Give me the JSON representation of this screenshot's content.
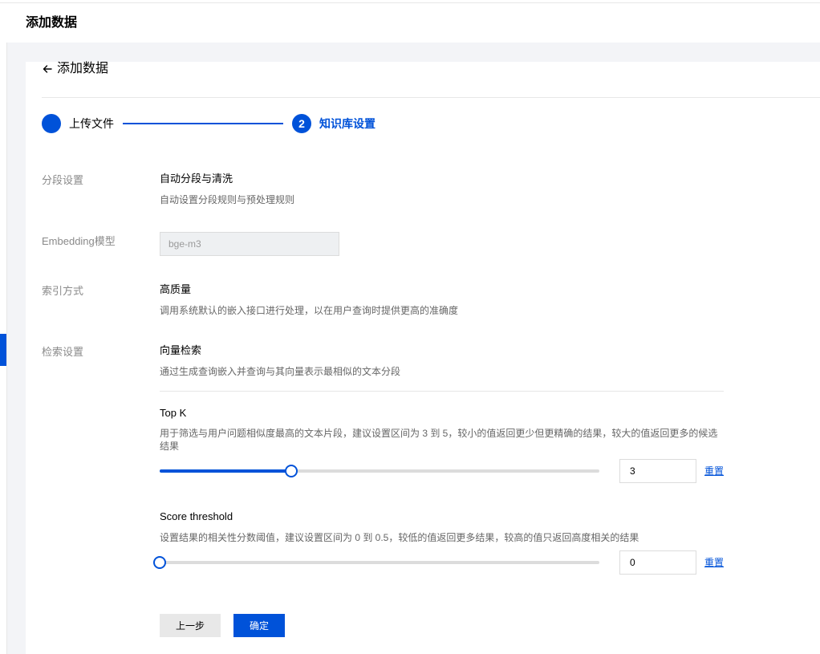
{
  "header": {
    "title": "添加数据"
  },
  "back": {
    "label": "添加数据"
  },
  "steps": [
    {
      "number": "",
      "label": "上传文件",
      "status": "done"
    },
    {
      "number": "2",
      "label": "知识库设置",
      "status": "active"
    }
  ],
  "form": {
    "segment": {
      "label": "分段设置",
      "option_title": "自动分段与清洗",
      "option_desc": "自动设置分段规则与预处理规则"
    },
    "embedding": {
      "label": "Embedding模型",
      "placeholder": "bge-m3"
    },
    "index": {
      "label": "索引方式",
      "option_title": "高质量",
      "option_desc": "调用系统默认的嵌入接口进行处理，以在用户查询时提供更高的准确度"
    },
    "retrieval": {
      "label": "检索设置",
      "option_title": "向量检索",
      "option_desc": "通过生成查询嵌入并查询与其向量表示最相似的文本分段"
    },
    "topk": {
      "title": "Top K",
      "desc": "用于筛选与用户问题相似度最高的文本片段，建议设置区间为 3 到 5，较小的值返回更少但更精确的结果，较大的值返回更多的候选结果",
      "value": "3",
      "slider_fraction": 0.3,
      "reset_label": "重置"
    },
    "score": {
      "title": "Score threshold",
      "desc": "设置结果的相关性分数阈值，建议设置区间为 0 到 0.5，较低的值返回更多结果，较高的值只返回高度相关的结果",
      "value": "0",
      "slider_fraction": 0,
      "reset_label": "重置"
    }
  },
  "buttons": {
    "prev_label": "上一步",
    "confirm_label": "确定"
  },
  "colors": {
    "accent": "#0052d9",
    "background": "#f3f4f7"
  }
}
